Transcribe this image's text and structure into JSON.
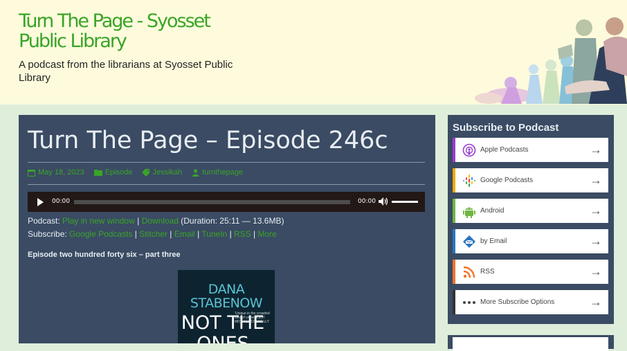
{
  "site": {
    "title": "Turn The Page - Syosset Public Library",
    "tagline": "A podcast from the librarians at Syosset Public Library"
  },
  "post": {
    "title": "Turn The Page – Episode 246c",
    "meta": {
      "date": "May 18, 2023",
      "category": "Episode",
      "tag": "Jessikah",
      "author": "turnthepage"
    },
    "player": {
      "current_time": "00:00",
      "duration_time": "00:00",
      "progress": 0
    },
    "podcast_line": {
      "label": "Podcast:",
      "play_link": "Play in new window",
      "sep": " | ",
      "download_link": "Download",
      "duration": " (Duration: 25:11 — 13.6MB)"
    },
    "subscribe_line": {
      "label": "Subscribe:",
      "links": [
        "Google Podcasts",
        "Stitcher",
        "Email",
        "TuneIn",
        "RSS",
        "More"
      ]
    },
    "subheading": "Episode two hundred forty six – part three",
    "book_cover": {
      "author": "DANA STABENOW",
      "title": "NOT THE ONES",
      "quote": "'Unique in the crowded field of crime fiction' MICHAEL CONNELLY"
    }
  },
  "sidebar": {
    "title": "Subscribe to Podcast",
    "buttons": [
      {
        "label": "Apple Podcasts",
        "icon": "apple-podcasts-icon",
        "color": "#9a3ccf"
      },
      {
        "label": "Google Podcasts",
        "icon": "google-podcasts-icon",
        "color": "#f2a900"
      },
      {
        "label": "Android",
        "icon": "android-icon",
        "color": "#6fb641"
      },
      {
        "label": "by Email",
        "icon": "email-icon",
        "color": "#2b74c2"
      },
      {
        "label": "RSS",
        "icon": "rss-icon",
        "color": "#f0752b"
      },
      {
        "label": "More Subscribe Options",
        "icon": "more-icon",
        "color": "#333333"
      }
    ],
    "arrow": "→"
  },
  "colors": {
    "accent_green": "#3aa428",
    "panel": "#3a4b63",
    "header_bg": "#fdfbdc",
    "page_bg": "#dfeedb"
  }
}
